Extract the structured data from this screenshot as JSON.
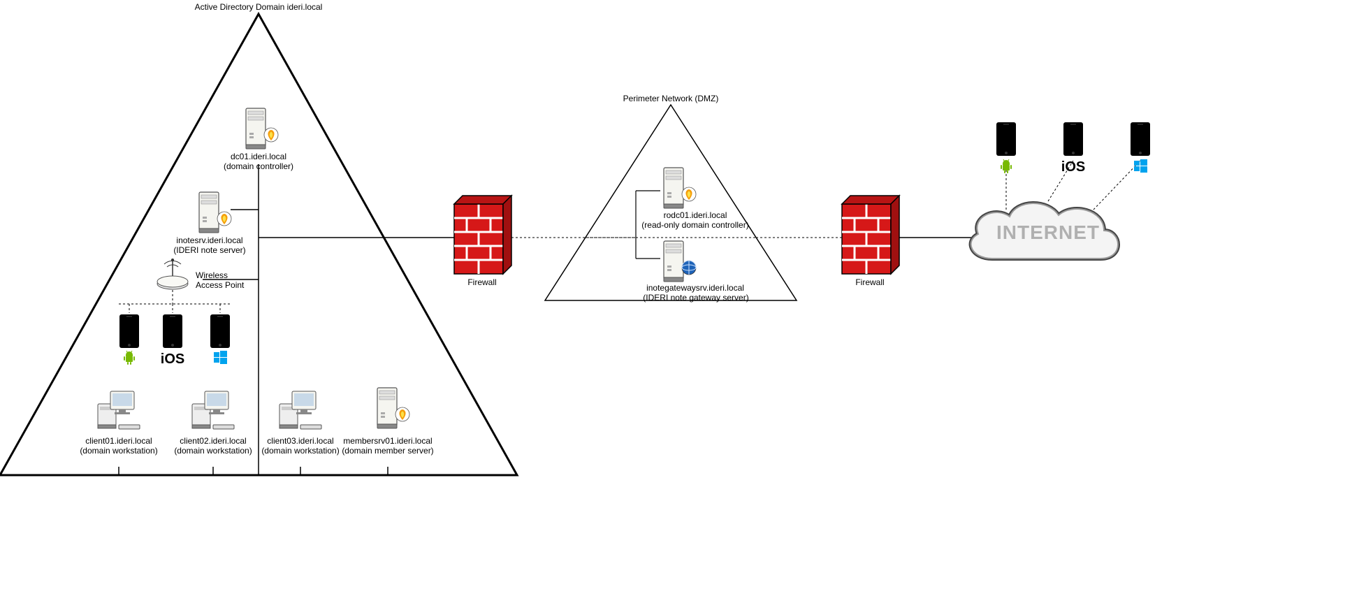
{
  "ad_domain": {
    "title": "Active Directory Domain ideri.local",
    "dc": {
      "hostname": "dc01.ideri.local",
      "role": "(domain controller)"
    },
    "noteserver": {
      "hostname": "inotesrv.ideri.local",
      "role": "(IDERI note server)"
    },
    "wap": {
      "line1": "Wireless",
      "line2": "Access Point"
    },
    "mobile_os": {
      "a": "android-icon",
      "b": "iOS",
      "c": "windows-icon"
    },
    "clients": [
      {
        "hostname": "client01.ideri.local",
        "role": "(domain workstation)"
      },
      {
        "hostname": "client02.ideri.local",
        "role": "(domain workstation)"
      },
      {
        "hostname": "client03.ideri.local",
        "role": "(domain workstation)"
      }
    ],
    "memberserver": {
      "hostname": "membersrv01.ideri.local",
      "role": "(domain member server)"
    }
  },
  "firewall1": {
    "label": "Firewall"
  },
  "dmz": {
    "title": "Perimeter Network (DMZ)",
    "rodc": {
      "hostname": "rodc01.ideri.local",
      "role": "(read-only domain controller)"
    },
    "gateway": {
      "hostname": "inotegatewaysrv.ideri.local",
      "role": "(IDERI note gateway server)"
    }
  },
  "firewall2": {
    "label": "Firewall"
  },
  "internet": {
    "label": "INTERNET",
    "mobile_os": {
      "a": "android-icon",
      "b": "iOS",
      "c": "windows-icon"
    }
  }
}
